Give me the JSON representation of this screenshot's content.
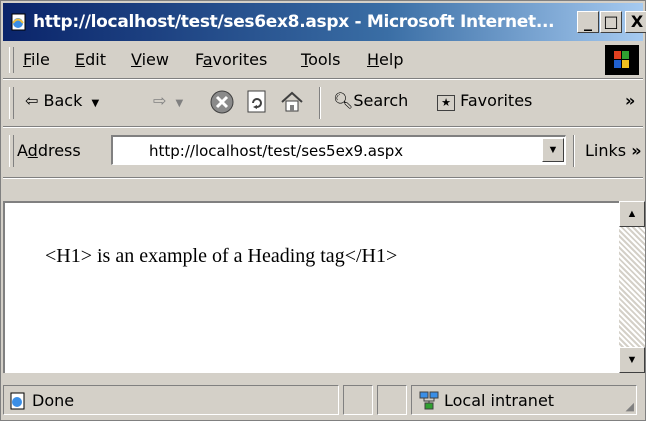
{
  "window": {
    "title": "http://localhost/test/ses6ex8.aspx - Microsoft Internet...",
    "minimize_label": "_",
    "maximize_label": "□",
    "close_label": "X"
  },
  "menu": {
    "items": [
      {
        "key": "F",
        "rest": "ile"
      },
      {
        "key": "E",
        "rest": "dit"
      },
      {
        "key": "V",
        "rest": "iew"
      },
      {
        "pre": "F",
        "key": "a",
        "rest": "vorites"
      },
      {
        "key": "T",
        "rest": "ools"
      },
      {
        "key": "H",
        "rest": "elp"
      }
    ]
  },
  "toolbar": {
    "back_label": "Back",
    "search_label": "Search",
    "favorites_label": "Favorites",
    "overflow_label": "»"
  },
  "address": {
    "label_key": "d",
    "label_pre": "A",
    "label_rest": "dress",
    "value": "http://localhost/test/ses5ex9.aspx",
    "links_label": "Links",
    "links_overflow": "»"
  },
  "content": {
    "text": "<H1> is an example of a Heading tag</H1>"
  },
  "status": {
    "left_text": "Done",
    "zone_text": "Local intranet"
  },
  "icons": {
    "title": "ie-page-icon",
    "stop": "stop-icon",
    "refresh": "refresh-icon",
    "home": "home-icon"
  }
}
